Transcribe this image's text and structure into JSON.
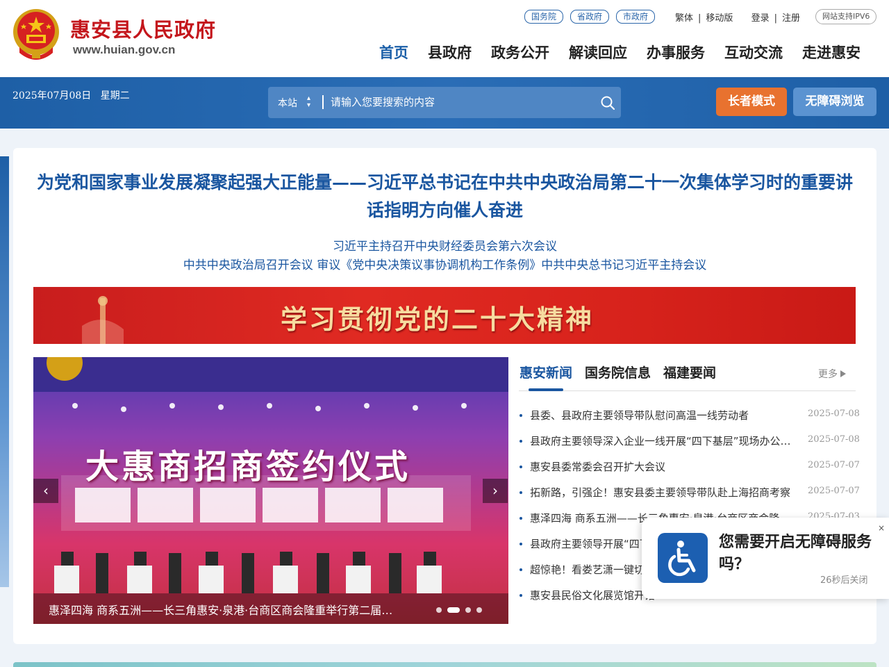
{
  "header": {
    "site_name": "惠安县人民政府",
    "site_url": "www.huian.gov.cn",
    "gov_links": [
      "国务院",
      "省政府",
      "市政府"
    ],
    "util_links": {
      "traditional": "繁体",
      "mobile": "移动版",
      "login": "登录",
      "register": "注册"
    },
    "ipv6_badge": "网站支持IPV6",
    "nav": [
      "首页",
      "县政府",
      "政务公开",
      "解读回应",
      "办事服务",
      "互动交流",
      "走进惠安"
    ],
    "active_nav": "首页"
  },
  "toolbar": {
    "date": "2025年07月08日",
    "weekday": "星期二",
    "search_scope": "本站",
    "search_placeholder": "请输入您要搜索的内容",
    "elder_mode_label": "长者模式",
    "accessible_label": "无障碍浏览",
    "elder_color": "#e8722f",
    "brand_color": "#1e5fa6"
  },
  "headline": {
    "title": "为党和国家事业发展凝聚起强大正能量——习近平总书记在中共中央政治局第二十一次集体学习时的重要讲话指明方向催人奋进",
    "sub1": "习近平主持召开中央财经委员会第六次会议",
    "sub2": "中共中央政治局召开会议 审议《党中央决策议事协调机构工作条例》中共中央总书记习近平主持会议"
  },
  "banner": {
    "text": "学习贯彻党的二十大精神"
  },
  "slider": {
    "caption": "惠泽四海 商系五洲——长三角惠安·泉港·台商区商会隆重举行第二届…",
    "slide_heading": "大惠商招商签约仪式",
    "dot_count": 5,
    "active_dot": 1,
    "prev_label": "‹",
    "next_label": "›"
  },
  "news": {
    "tabs": [
      "惠安新闻",
      "国务院信息",
      "福建要闻"
    ],
    "active_tab": "惠安新闻",
    "more_label": "更多",
    "items": [
      {
        "title": "县委、县政府主要领导带队慰问高温一线劳动者",
        "date": "2025-07-08"
      },
      {
        "title": "县政府主要领导深入企业一线开展“四下基层”现场办公…",
        "date": "2025-07-08"
      },
      {
        "title": "惠安县委常委会召开扩大会议",
        "date": "2025-07-07"
      },
      {
        "title": "拓新路，引强企！惠安县委主要领导带队赴上海招商考察",
        "date": "2025-07-07"
      },
      {
        "title": "惠泽四海 商系五洲——长三角惠安·泉港·台商区商会隆…",
        "date": "2025-07-03"
      },
      {
        "title": "县政府主要领导开展“四下基层”…",
        "date": ""
      },
      {
        "title": "超惊艳！看娄艺潇一键切换…",
        "date": ""
      },
      {
        "title": "惠安县民俗文化展览馆开馆…",
        "date": ""
      }
    ]
  },
  "popup": {
    "message": "您需要开启无障碍服务吗？",
    "timer": "26秒后关闭",
    "close_label": "×",
    "icon": "wheelchair-icon"
  }
}
